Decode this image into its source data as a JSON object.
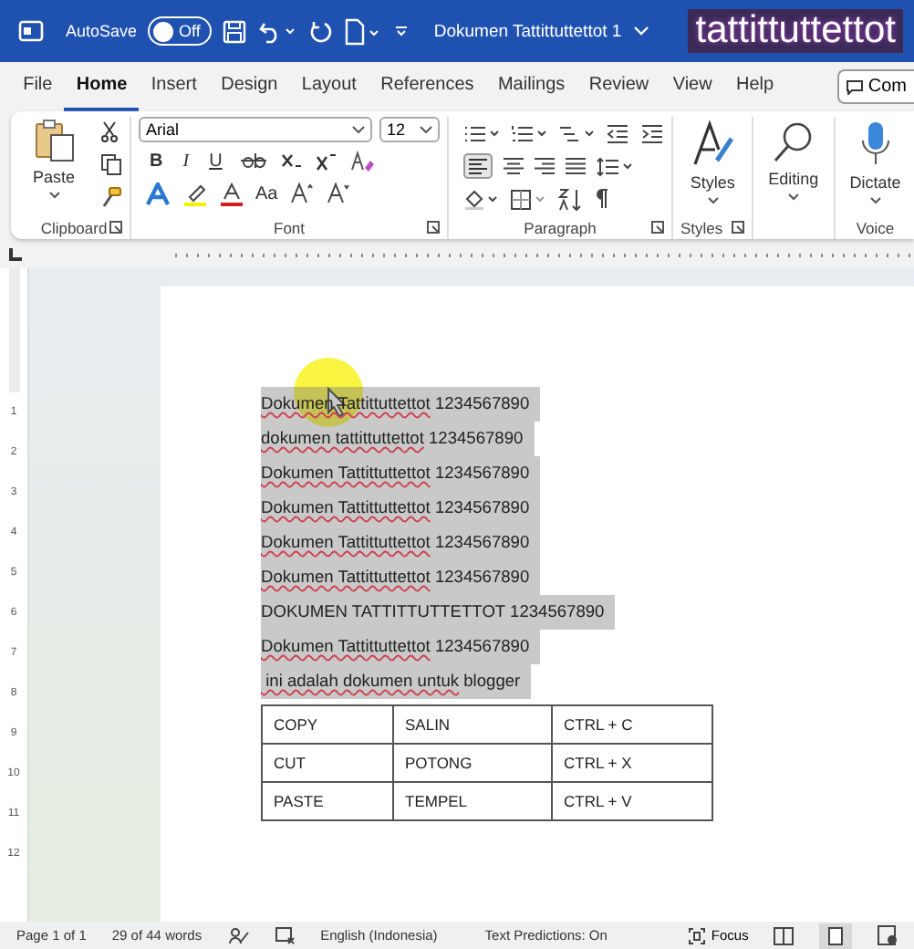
{
  "title_bar": {
    "autosave_label": "AutoSave",
    "autosave": {
      "on": false,
      "label": "Off"
    },
    "document_title": "Dokumen Tattittuttettot 1",
    "overlay_caption": "tattittuttettot"
  },
  "tabs": [
    {
      "label": "File",
      "selected": false
    },
    {
      "label": "Home",
      "selected": true
    },
    {
      "label": "Insert",
      "selected": false
    },
    {
      "label": "Design",
      "selected": false
    },
    {
      "label": "Layout",
      "selected": false
    },
    {
      "label": "References",
      "selected": false
    },
    {
      "label": "Mailings",
      "selected": false
    },
    {
      "label": "Review",
      "selected": false
    },
    {
      "label": "View",
      "selected": false
    },
    {
      "label": "Help",
      "selected": false
    }
  ],
  "comments_button": "Com",
  "ribbon": {
    "paste_label": "Paste",
    "font_name": "Arial",
    "font_size": "12",
    "format_letters": [
      "B",
      "I",
      "U"
    ],
    "change_case": "Aa",
    "styles_label": "Styles",
    "editing_label": "Editing",
    "dictate_label": "Dictate",
    "groups": [
      "Clipboard",
      "Font",
      "Paragraph",
      "Styles",
      "Voice"
    ]
  },
  "vertical_ruler": [
    "1",
    "2",
    "3",
    "4",
    "5",
    "6",
    "7",
    "8",
    "9",
    "10",
    "11",
    "12"
  ],
  "document": {
    "lines": [
      {
        "selected": true,
        "parts": [
          {
            "text": "Dokumen Tattittuttettot",
            "misspelled": true
          },
          {
            "text": " 1234567890",
            "misspelled": false
          }
        ]
      },
      {
        "selected": true,
        "parts": [
          {
            "text": "dokumen tattittuttettot",
            "misspelled": true
          },
          {
            "text": " 1234567890",
            "misspelled": false
          }
        ]
      },
      {
        "selected": true,
        "parts": [
          {
            "text": "Dokumen Tattittuttettot",
            "misspelled": true
          },
          {
            "text": " 1234567890",
            "misspelled": false
          }
        ]
      },
      {
        "selected": true,
        "parts": [
          {
            "text": "Dokumen Tattittuttettot",
            "misspelled": true
          },
          {
            "text": " 1234567890",
            "misspelled": false
          }
        ]
      },
      {
        "selected": true,
        "parts": [
          {
            "text": "Dokumen Tattittuttettot",
            "misspelled": true
          },
          {
            "text": " 1234567890",
            "misspelled": false
          }
        ]
      },
      {
        "selected": true,
        "parts": [
          {
            "text": "Dokumen Tattittuttettot",
            "misspelled": true
          },
          {
            "text": " 1234567890",
            "misspelled": false
          }
        ]
      },
      {
        "selected": true,
        "parts": [
          {
            "text": "DOKUMEN TATTITTUTTETTOT 1234567890",
            "misspelled": false
          }
        ]
      },
      {
        "selected": true,
        "parts": [
          {
            "text": "Dokumen Tattittuttettot",
            "misspelled": true
          },
          {
            "text": " 1234567890",
            "misspelled": false
          }
        ]
      },
      {
        "selected": true,
        "parts": [
          {
            "text": " ini adalah dokumen untuk",
            "misspelled": true
          },
          {
            "text": " blogger",
            "misspelled": false
          }
        ]
      }
    ],
    "table": [
      [
        "COPY",
        "SALIN",
        "CTRL + C"
      ],
      [
        "CUT",
        "POTONG",
        "CTRL + X"
      ],
      [
        "PASTE",
        "TEMPEL",
        "CTRL + V"
      ]
    ]
  },
  "status_bar": {
    "page": "Page 1 of 1",
    "words": "29 of 44 words",
    "language": "English (Indonesia)",
    "predictions": "Text Predictions: On",
    "focus": "Focus"
  }
}
